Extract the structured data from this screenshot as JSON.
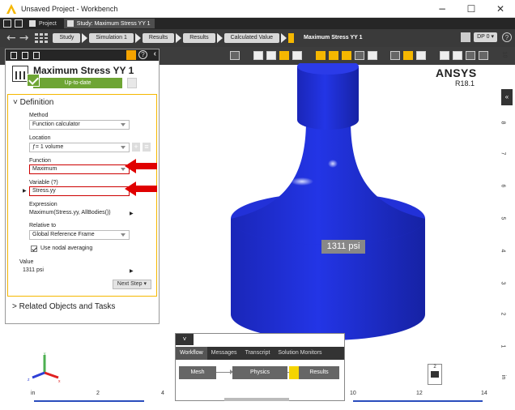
{
  "window": {
    "title": "Unsaved Project - Workbench",
    "controls": [
      "−",
      "☐",
      "✕"
    ]
  },
  "tabs": [
    {
      "label": "Project",
      "active": false
    },
    {
      "label": "Study: Maximum Stress YY 1",
      "active": true
    }
  ],
  "breadcrumb": {
    "items": [
      "Study",
      "Simulation 1",
      "Results",
      "Results",
      "Calculated Value",
      "Maximum Stress YY 1"
    ],
    "dp_label": "DP 0 ▾"
  },
  "panel": {
    "title": "Maximum Stress YY 1",
    "status": "Up-to-date",
    "definition_header": "Definition",
    "method": {
      "label": "Method",
      "value": "Function calculator"
    },
    "location": {
      "label": "Location",
      "value": "ƒ= 1 volume"
    },
    "function": {
      "label": "Function",
      "value": "Maximum"
    },
    "variable": {
      "label": "Variable (?)",
      "value": "Stress.yy"
    },
    "expression": {
      "label": "Expression",
      "value": "Maximum(Stress.yy, AllBodies())"
    },
    "relative_to": {
      "label": "Relative to",
      "value": "Global Reference Frame"
    },
    "nodal_averaging": {
      "label": "Use nodal averaging",
      "checked": true
    },
    "value": {
      "label": "Value",
      "value": "1311 psi"
    },
    "next_step": "Next Step ▾",
    "related": "Related Objects and Tasks"
  },
  "viewport": {
    "brand": "ANSYS",
    "version": "R18.1",
    "result_label": "1311 psi",
    "model_color": "#1f2fd6",
    "bottom_scale": [
      "in",
      "2",
      "4",
      "10",
      "12",
      "14"
    ],
    "right_scale": [
      "10",
      "8",
      "7",
      "6",
      "5",
      "4",
      "3",
      "2",
      "1",
      "in"
    ],
    "count": "2"
  },
  "workflow": {
    "collapse": "˅",
    "tabs": [
      "Workflow",
      "Messages",
      "Transcript",
      "Solution Monitors"
    ],
    "nodes": [
      "Mesh",
      "Physics",
      "Results"
    ]
  },
  "colors": {
    "accent": "#f5b700",
    "status_green": "#6ea534",
    "highlight_red": "#cc0000"
  }
}
